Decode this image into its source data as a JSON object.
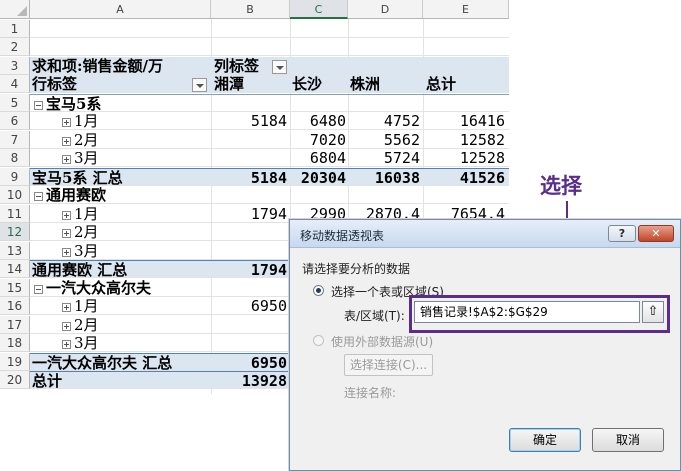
{
  "columns": [
    "A",
    "B",
    "C",
    "D",
    "E"
  ],
  "rows": [
    "1",
    "2",
    "3",
    "4",
    "5",
    "6",
    "7",
    "8",
    "9",
    "10",
    "11",
    "12",
    "13",
    "14",
    "15",
    "16",
    "17",
    "18",
    "19",
    "20"
  ],
  "pivot": {
    "r3": {
      "a": "求和项:销售金额/万",
      "b": "列标签"
    },
    "r4": {
      "a": "行标签",
      "b": "湘潭",
      "c": "长沙",
      "d": "株洲",
      "e": "总计"
    },
    "r5": {
      "a": "宝马5系"
    },
    "r6": {
      "a": "1月",
      "b": "5184",
      "c": "6480",
      "d": "4752",
      "e": "16416"
    },
    "r7": {
      "a": "2月",
      "c": "7020",
      "d": "5562",
      "e": "12582"
    },
    "r8": {
      "a": "3月",
      "c": "6804",
      "d": "5724",
      "e": "12528"
    },
    "r9": {
      "a": "宝马5系 汇总",
      "b": "5184",
      "c": "20304",
      "d": "16038",
      "e": "41526"
    },
    "r10": {
      "a": "通用赛欧"
    },
    "r11": {
      "a": "1月",
      "b": "1794",
      "c": "2990",
      "d": "2870.4",
      "e": "7654.4"
    },
    "r12": {
      "a": "2月"
    },
    "r13": {
      "a": "3月"
    },
    "r14": {
      "a": "通用赛欧 汇总",
      "b": "1794"
    },
    "r15": {
      "a": "一汽大众高尔夫"
    },
    "r16": {
      "a": "1月",
      "b": "6950"
    },
    "r17": {
      "a": "2月"
    },
    "r18": {
      "a": "3月"
    },
    "r19": {
      "a": "一汽大众高尔夫 汇总",
      "b": "6950"
    },
    "r20": {
      "a": "总计",
      "b": "13928"
    }
  },
  "callout": {
    "label": "选择"
  },
  "dialog": {
    "title": "移动数据透视表",
    "help_label": "?",
    "close_label": "✕",
    "section_label": "请选择要分析的数据",
    "option_table": "选择一个表或区域(S)",
    "range_label": "表/区域(T):",
    "range_value": "销售记录!$A$2:$G$29",
    "range_button": "⇧",
    "option_external": "使用外部数据源(U)",
    "choose_connection": "选择连接(C)...",
    "connection_name": "连接名称:",
    "ok_label": "确定",
    "cancel_label": "取消"
  },
  "colors": {
    "accent": "#5a2d8c",
    "pivot_band": "#dce6f1",
    "excel_green": "#217346"
  }
}
